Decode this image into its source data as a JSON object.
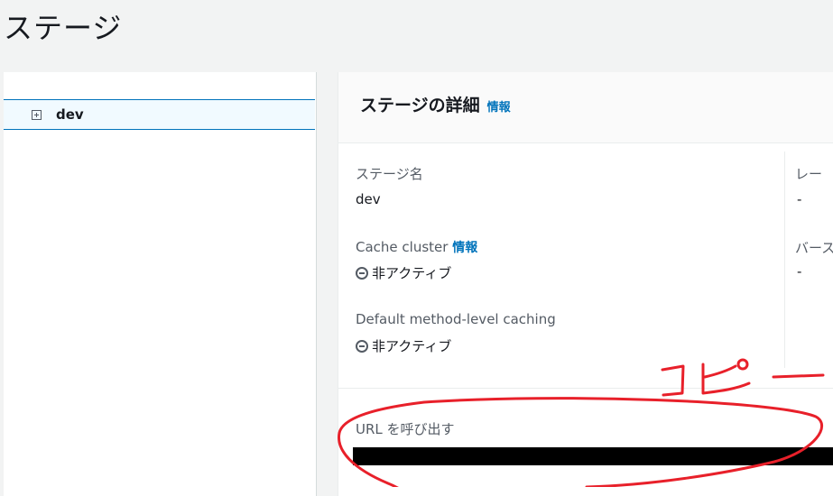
{
  "page": {
    "title": "ステージ"
  },
  "tree": {
    "items": [
      {
        "label": "dev",
        "selected": true
      }
    ]
  },
  "stage_details": {
    "title": "ステージの詳細",
    "info_link": "情報",
    "fields": {
      "stage_name": {
        "label": "ステージ名",
        "value": "dev"
      },
      "cache_cluster": {
        "label": "Cache cluster",
        "info_link": "情報",
        "status": "非アクティブ"
      },
      "default_caching": {
        "label": "Default method-level caching",
        "status": "非アクティブ"
      },
      "rate": {
        "label": "レー",
        "value": "-"
      },
      "burst": {
        "label": "バース",
        "value": "-"
      }
    },
    "invoke_url": {
      "label": "URL を呼び出す"
    }
  },
  "annotation": {
    "text": "コピー",
    "color": "#e8202a"
  }
}
